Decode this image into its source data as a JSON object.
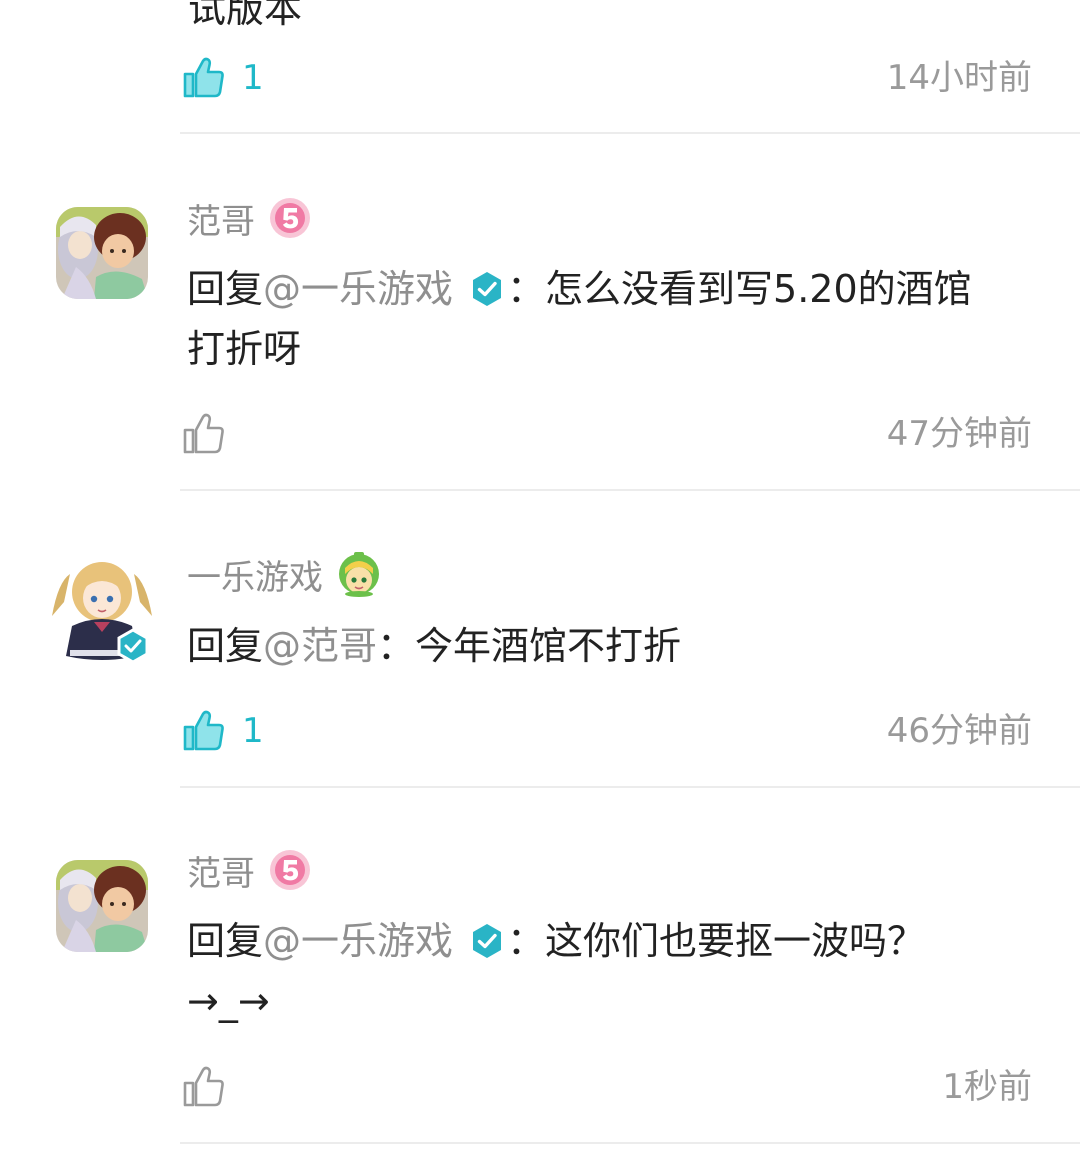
{
  "top_partial_text": "试版本",
  "comments": [
    {
      "likes": "1",
      "liked": true,
      "time": "14小时前"
    },
    {
      "user": "范哥",
      "reply_prefix": "回复",
      "mention": "@一乐游戏",
      "mention_verified": true,
      "separator": "：",
      "text_line1": "怎么没看到写5.20的酒馆",
      "text_line2": "打折呀",
      "likes": "",
      "liked": false,
      "time": "47分钟前",
      "level_badge_icon": "level-5-badge",
      "avatar_icon": "anime-duo-avatar"
    },
    {
      "user": "一乐游戏",
      "reply_prefix": "回复",
      "mention": "@范哥",
      "mention_verified": false,
      "separator": "：",
      "text_line1": "今年酒馆不打折",
      "text_line2": "",
      "likes": "1",
      "liked": true,
      "time": "46分钟前",
      "badge_icon": "green-haired-character-badge",
      "avatar_icon": "anime-girl-avatar",
      "avatar_verified": true
    },
    {
      "user": "范哥",
      "reply_prefix": "回复",
      "mention": "@一乐游戏",
      "mention_verified": true,
      "separator": "：",
      "text_line1": "这你们也要抠一波吗？",
      "text_line2": "→_→",
      "likes": "",
      "liked": false,
      "time": "1秒前",
      "level_badge_icon": "level-5-badge",
      "avatar_icon": "anime-duo-avatar"
    }
  ],
  "colors": {
    "accent": "#1fb8c8",
    "muted_text": "#8f8f8f",
    "time_text": "#9a9a9a",
    "divider": "#ececec",
    "level_badge": "#f07aa4"
  }
}
